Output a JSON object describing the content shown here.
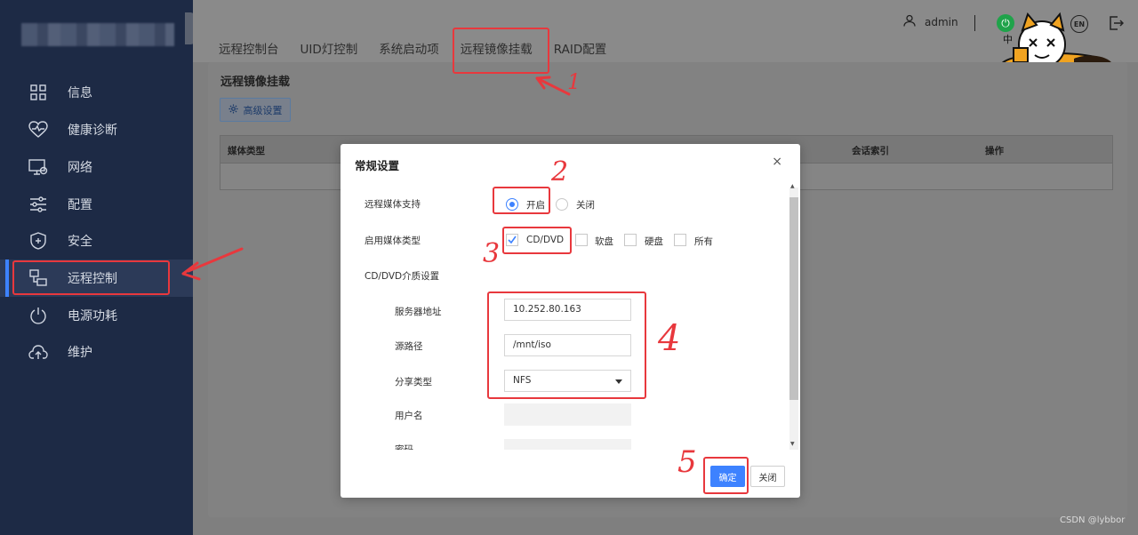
{
  "header": {
    "tabs": [
      "远程控制台",
      "UID灯控制",
      "系统启动项",
      "远程镜像挂载",
      "RAID配置"
    ],
    "user": "admin",
    "lang_cn": "中",
    "lang_en": "EN"
  },
  "sidebar": {
    "items": [
      {
        "label": "信息",
        "icon": "grid-icon"
      },
      {
        "label": "健康诊断",
        "icon": "heart-pulse-icon"
      },
      {
        "label": "网络",
        "icon": "network-monitor-icon"
      },
      {
        "label": "配置",
        "icon": "sliders-icon"
      },
      {
        "label": "安全",
        "icon": "shield-icon"
      },
      {
        "label": "远程控制",
        "icon": "remote-control-icon"
      },
      {
        "label": "电源功耗",
        "icon": "power-icon"
      },
      {
        "label": "维护",
        "icon": "cloud-upload-icon"
      }
    ]
  },
  "main": {
    "title": "远程镜像挂载",
    "advanced_button": "高级设置",
    "table_headers": [
      "媒体类型",
      "会话索引",
      "操作"
    ]
  },
  "dialog": {
    "title": "常规设置",
    "close": "×",
    "remote_media_label": "远程媒体支持",
    "radio_on": "开启",
    "radio_off": "关闭",
    "media_type_label": "启用媒体类型",
    "media_types": [
      "CD/DVD",
      "软盘",
      "硬盘",
      "所有"
    ],
    "section_label": "CD/DVD介质设置",
    "server_label": "服务器地址",
    "server_value": "10.252.80.163",
    "path_label": "源路径",
    "path_value": "/mnt/iso",
    "share_label": "分享类型",
    "share_value": "NFS",
    "username_label": "用户名",
    "password_label": "密码",
    "ok": "确定",
    "cancel": "关闭"
  },
  "annotations": [
    "1",
    "2",
    "3",
    "4",
    "5"
  ],
  "watermark": "CSDN @lybbor"
}
